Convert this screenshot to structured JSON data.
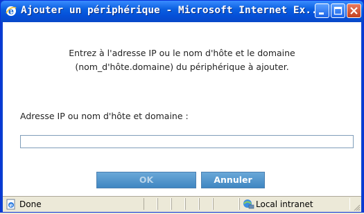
{
  "window": {
    "title": "Ajouter un périphérique - Microsoft Internet Ex..."
  },
  "dialog": {
    "instruction_line1": "Entrez à l'adresse IP ou le nom d'hôte et le domaine",
    "instruction_line2": "(nom_d'hôte.domaine) du périphérique à ajouter.",
    "field_label": "Adresse IP ou nom d'hôte et domaine :",
    "field_value": "",
    "ok_label": "OK",
    "cancel_label": "Annuler"
  },
  "statusbar": {
    "status_text": "Done",
    "zone_text": "Local intranet"
  },
  "colors": {
    "titlebar": "#0a5fe0",
    "button": "#3f86c2",
    "close": "#c4411f"
  }
}
